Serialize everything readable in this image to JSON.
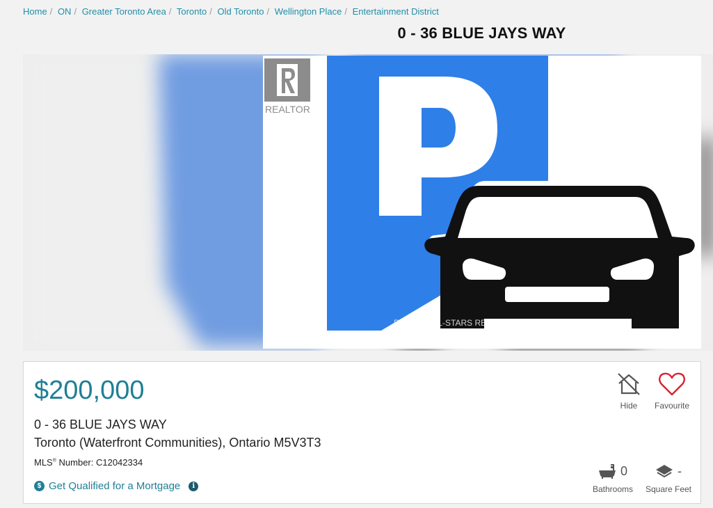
{
  "breadcrumb": [
    "Home",
    "ON",
    "Greater Toronto Area",
    "Toronto",
    "Old Toronto",
    "Wellington Place",
    "Entertainment District"
  ],
  "page_title": "0 - 36 BLUE JAYS WAY",
  "photo": {
    "watermark": "RE/MAX ALL-STARS REALTY INC., Brokerage",
    "logo_text": "REALTOR",
    "sign_letter": "P",
    "colors": {
      "pin": "#2f7fe8",
      "car": "#111111"
    }
  },
  "listing": {
    "price": "$200,000",
    "address_line1": "0 - 36 BLUE JAYS WAY",
    "address_line2": "Toronto (Waterfront Communities), Ontario M5V3T3",
    "mls_prefix": "MLS",
    "mls_suffix": " Number: C12042334",
    "mortgage_link": "Get Qualified for a Mortgage",
    "info_glyph": "i",
    "dollar_glyph": "$"
  },
  "actions": {
    "hide_label": "Hide",
    "favourite_label": "Favourite"
  },
  "stats": {
    "bathrooms_value": "0",
    "bathrooms_label": "Bathrooms",
    "sqft_value": "-",
    "sqft_label": "Square Feet"
  },
  "colors": {
    "accent": "#1f7f95",
    "link": "#1f8fa8",
    "favourite": "#d7232e"
  }
}
